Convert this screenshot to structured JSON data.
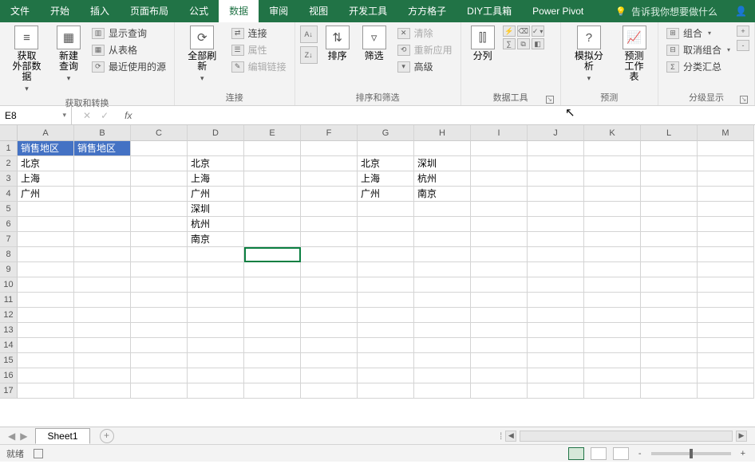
{
  "tabs": [
    "文件",
    "开始",
    "插入",
    "页面布局",
    "公式",
    "数据",
    "审阅",
    "视图",
    "开发工具",
    "方方格子",
    "DIY工具箱",
    "Power Pivot"
  ],
  "active_tab_index": 5,
  "tell_me": "告诉我你想要做什么",
  "ribbon": {
    "g1": {
      "label": "获取和转换",
      "big1": "获取\n外部数据",
      "big2": "新建\n查询",
      "s1": "显示查询",
      "s2": "从表格",
      "s3": "最近使用的源"
    },
    "g2": {
      "label": "连接",
      "big": "全部刷新",
      "s1": "连接",
      "s2": "属性",
      "s3": "编辑链接"
    },
    "g3": {
      "label": "排序和筛选",
      "sort": "排序",
      "filter": "筛选",
      "s1": "清除",
      "s2": "重新应用",
      "s3": "高级"
    },
    "g4": {
      "label": "数据工具",
      "split": "分列"
    },
    "g5": {
      "label": "预测",
      "sim": "模拟分析",
      "fs": "预测\n工作表"
    },
    "g6": {
      "label": "分级显示",
      "s1": "组合",
      "s2": "取消组合",
      "s3": "分类汇总"
    }
  },
  "name_box": "E8",
  "fx": "fx",
  "columns": [
    "A",
    "B",
    "C",
    "D",
    "E",
    "F",
    "G",
    "H",
    "I",
    "J",
    "K",
    "L",
    "M"
  ],
  "row_count": 17,
  "cells": {
    "A1": "销售地区",
    "B1": "销售地区",
    "A2": "北京",
    "A3": "上海",
    "A4": "广州",
    "D2": "北京",
    "D3": "上海",
    "D4": "广州",
    "D5": "深圳",
    "D6": "杭州",
    "D7": "南京",
    "G2": "北京",
    "G3": "上海",
    "G4": "广州",
    "H2": "深圳",
    "H3": "杭州",
    "H4": "南京"
  },
  "header_cells": [
    "A1",
    "B1"
  ],
  "selected_cell": "E8",
  "sheet_name": "Sheet1",
  "status_text": "就绪",
  "zoom_plus": "+",
  "zoom_minus": "-"
}
